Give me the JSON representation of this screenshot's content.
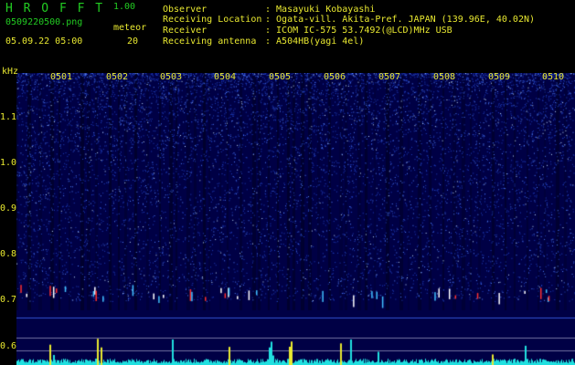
{
  "header": {
    "app_title": "H R O F F T",
    "app_version": "1.00",
    "file_name": "0509220500.png",
    "meteor_label": "meteor",
    "date_time": "05.09.22 05:00",
    "meteor_count": "20"
  },
  "info": [
    {
      "label": "Observer",
      "value": ": Masayuki Kobayashi"
    },
    {
      "label": "Receiving Location",
      "value": ": Ogata-vill. Akita-Pref. JAPAN (139.96E, 40.02N)"
    },
    {
      "label": "Receiver",
      "value": ": ICOM IC-575 53.7492(@LCD)MHz USB"
    },
    {
      "label": "Receiving antenna",
      "value": ": A504HB(yagi 4el)"
    }
  ],
  "y_axis": {
    "unit": "kHz",
    "ticks": [
      "1.1",
      "1.0",
      "0.9",
      "0.8",
      "0.7",
      "0.6"
    ]
  },
  "x_axis": {
    "ticks": [
      "0501",
      "0502",
      "0503",
      "0504",
      "0505",
      "0506",
      "0507",
      "0508",
      "0509",
      "0510"
    ]
  },
  "colors": {
    "background": "#000000",
    "spectrogram_bg": "#000045",
    "title_green": "#22cc22",
    "label_yellow": "#e8e830",
    "histogram_cyan": "#20e0e0",
    "meteor_echo_red": "#ff3030"
  }
}
